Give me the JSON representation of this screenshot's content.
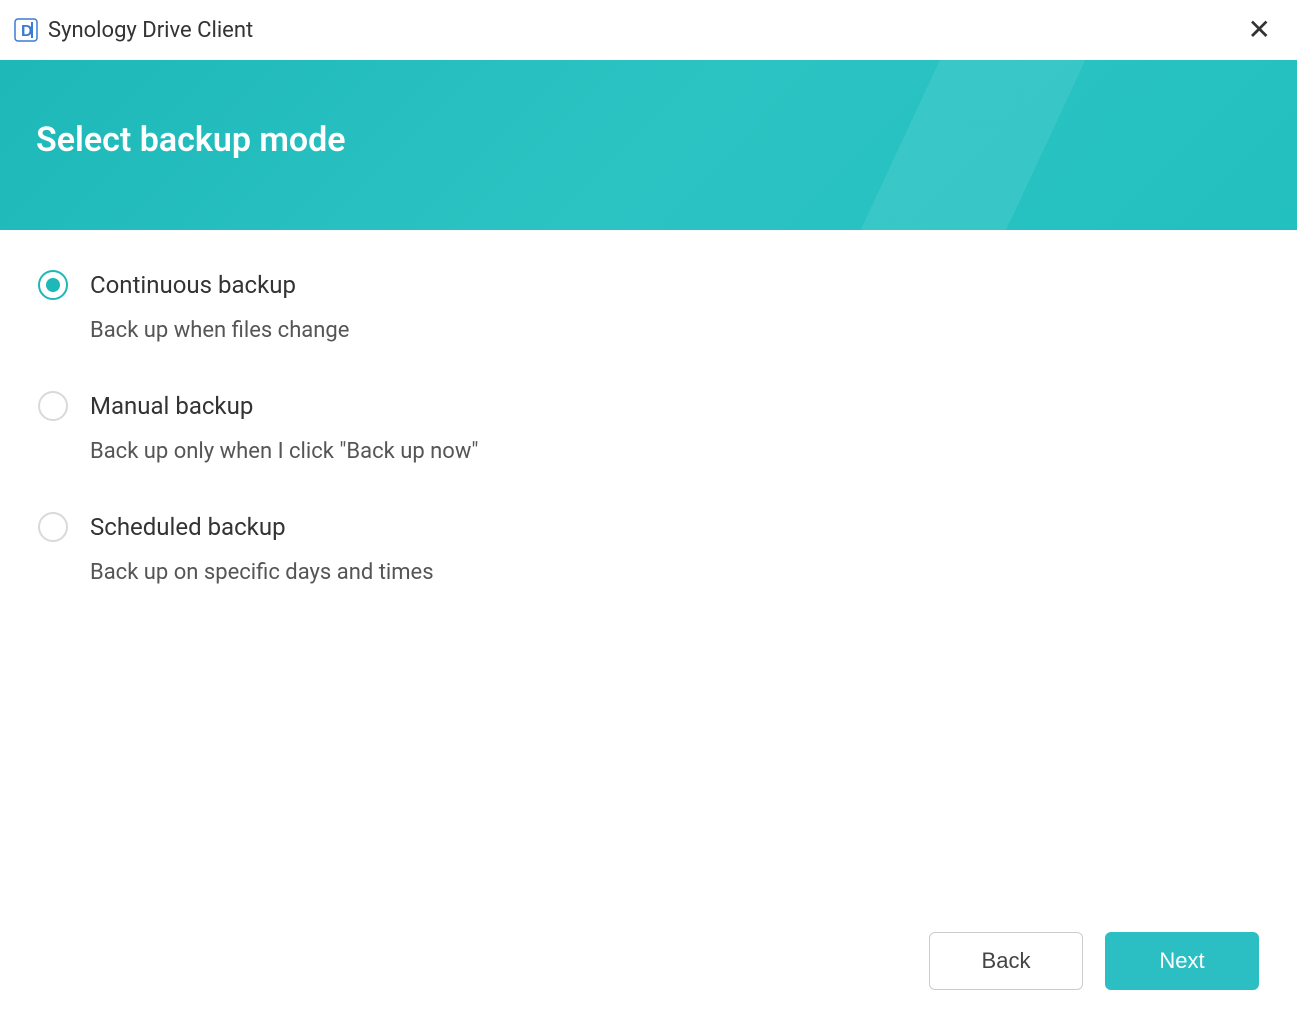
{
  "titlebar": {
    "app_name": "Synology Drive Client"
  },
  "header": {
    "title": "Select backup mode"
  },
  "options": [
    {
      "label": "Continuous backup",
      "description": "Back up when files change",
      "selected": true
    },
    {
      "label": "Manual backup",
      "description": "Back up only when I click \"Back up now\"",
      "selected": false
    },
    {
      "label": "Scheduled backup",
      "description": "Back up on specific days and times",
      "selected": false
    }
  ],
  "footer": {
    "back_label": "Back",
    "next_label": "Next"
  }
}
